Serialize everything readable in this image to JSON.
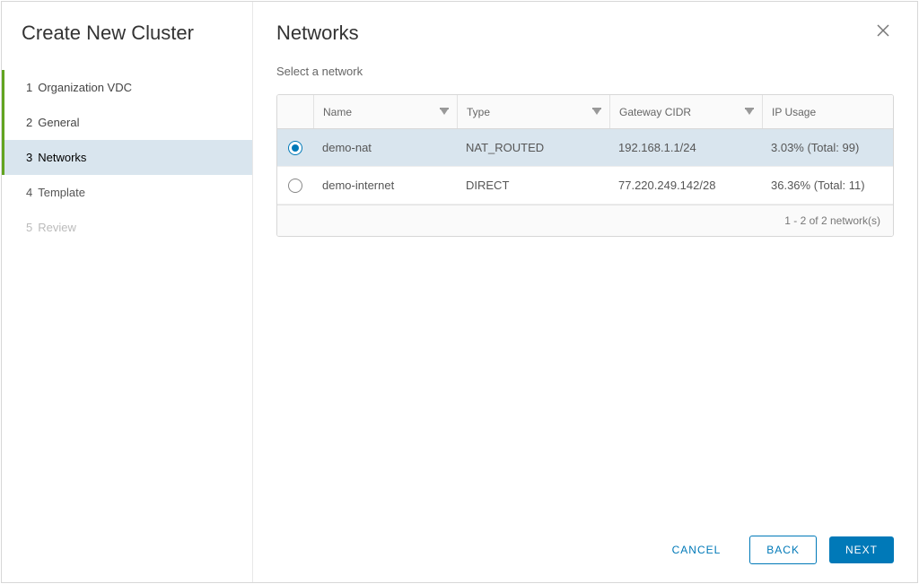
{
  "sidebar": {
    "title": "Create New Cluster",
    "steps": [
      {
        "num": "1",
        "label": "Organization VDC",
        "state": "completed"
      },
      {
        "num": "2",
        "label": "General",
        "state": "completed"
      },
      {
        "num": "3",
        "label": "Networks",
        "state": "current"
      },
      {
        "num": "4",
        "label": "Template",
        "state": "pending"
      },
      {
        "num": "5",
        "label": "Review",
        "state": "disabled"
      }
    ]
  },
  "main": {
    "title": "Networks",
    "subtitle": "Select a network",
    "columns": {
      "name": "Name",
      "type": "Type",
      "gateway": "Gateway CIDR",
      "ip": "IP Usage"
    },
    "rows": [
      {
        "selected": true,
        "name": "demo-nat",
        "type": "NAT_ROUTED",
        "gateway": "192.168.1.1/24",
        "ip": "3.03% (Total: 99)"
      },
      {
        "selected": false,
        "name": "demo-internet",
        "type": "DIRECT",
        "gateway": "77.220.249.142/28",
        "ip": "36.36% (Total: 11)"
      }
    ],
    "footer_count": "1 - 2 of 2 network(s)"
  },
  "buttons": {
    "cancel": "CANCEL",
    "back": "BACK",
    "next": "NEXT"
  }
}
